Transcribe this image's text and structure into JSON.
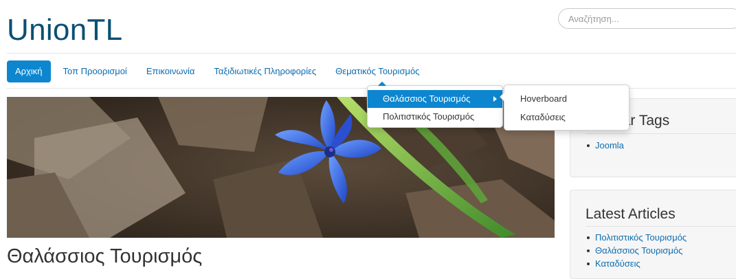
{
  "site": {
    "title": "UnionTL"
  },
  "search": {
    "placeholder": "Αναζήτηση..."
  },
  "nav": {
    "items": [
      {
        "label": "Αρχική",
        "active": true
      },
      {
        "label": "Τοπ Προορισμοί"
      },
      {
        "label": "Επικοινωνία"
      },
      {
        "label": "Ταξιδιωτικές Πληροφορίες"
      },
      {
        "label": "Θεματικός Τουρισμός"
      }
    ]
  },
  "dropdown": {
    "items": [
      {
        "label": "Θαλάσσιος Τουρισμός",
        "active": true
      },
      {
        "label": "Πολιτιστικός Τουρισμός"
      }
    ]
  },
  "submenu": {
    "items": [
      {
        "label": "Hoverboard"
      },
      {
        "label": "Καταδύσεις"
      }
    ]
  },
  "article": {
    "title": "Θαλάσσιος Τουρισμός"
  },
  "sidebar": {
    "tags_panel": {
      "title": "Popular Tags",
      "items": [
        "Joomla"
      ]
    },
    "latest_panel": {
      "title": "Latest Articles",
      "items": [
        "Πολιτιστικός Τουρισμός",
        "Θαλάσσιος Τουρισμός",
        "Καταδύσεις"
      ]
    }
  },
  "colors": {
    "accent": "#0d86cf",
    "logo": "#0b4f73",
    "link": "#0b6cb0"
  }
}
